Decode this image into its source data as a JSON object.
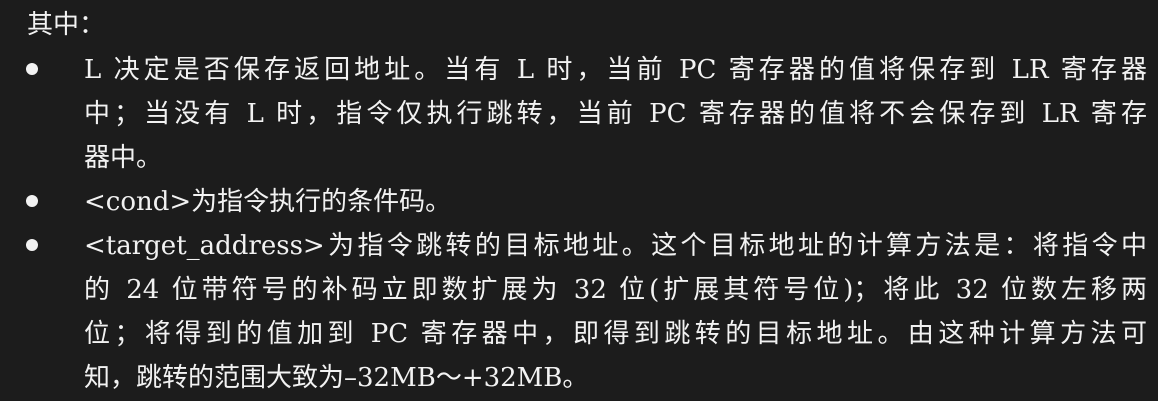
{
  "document": {
    "intro": "其中：",
    "bullets": [
      {
        "lines": [
          "L 决定是否保存返回地址。当有 L 时，当前 PC 寄存器的值将保存到 LR 寄存器",
          "中；当没有 L 时，指令仅执行跳转，当前 PC 寄存器的值将不会保存到 LR 寄存",
          "器中。"
        ]
      },
      {
        "lines": [
          "<cond>为指令执行的条件码。"
        ]
      },
      {
        "lines": [
          "<target_address>为指令跳转的目标地址。这个目标地址的计算方法是：将指令中",
          "的 24 位带符号的补码立即数扩展为 32 位(扩展其符号位)；将此 32 位数左移两",
          "位；将得到的值加到 PC 寄存器中，即得到跳转的目标地址。由这种计算方法可",
          "知，跳转的范围大致为–32MB～+32MB。"
        ]
      }
    ]
  }
}
